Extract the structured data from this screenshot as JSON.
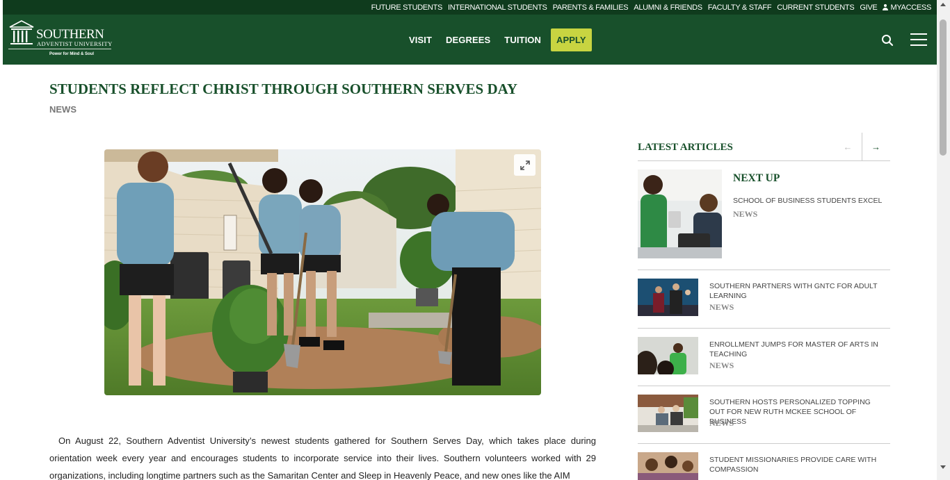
{
  "utility_nav": [
    "FUTURE STUDENTS",
    "INTERNATIONAL STUDENTS",
    "PARENTS & FAMILIES",
    "ALUMNI & FRIENDS",
    "FACULTY & STAFF",
    "CURRENT STUDENTS",
    "GIVE",
    "MYACCESS"
  ],
  "logo": {
    "line1": "SOUTHERN",
    "line2": "ADVENTIST UNIVERSITY",
    "tagline": "Power for Mind & Soul"
  },
  "main_nav": {
    "visit": "VISIT",
    "degrees": "DEGREES",
    "tuition": "TUITION",
    "apply": "APPLY"
  },
  "article": {
    "title": "STUDENTS REFLECT CHRIST THROUGH SOUTHERN SERVES DAY",
    "category": "NEWS",
    "hero_alt": "Students digging and planting shrubs in a yard",
    "body": "On August 22, Southern Adventist University’s newest students gathered for Southern Serves Day, which takes place during orientation week every year and encourages students to incorporate service into their lives. Southern volunteers worked with 29 organizations, including longtime partners such as the Samaritan Center and Sleep in Heavenly Peace, and new ones like the AIM"
  },
  "sidebar": {
    "heading": "LATEST ARTICLES",
    "prev": "←",
    "next": "→",
    "featured": {
      "label": "NEXT UP",
      "title": "SCHOOL OF BUSINESS STUDENTS EXCEL",
      "category": "NEWS"
    },
    "items": [
      {
        "title": "SOUTHERN PARTNERS WITH GNTC FOR ADULT LEARNING",
        "category": "NEWS"
      },
      {
        "title": "ENROLLMENT JUMPS FOR MASTER OF ARTS IN TEACHING",
        "category": "NEWS"
      },
      {
        "title": "SOUTHERN HOSTS PERSONALIZED TOPPING OUT FOR NEW RUTH MCKEE SCHOOL OF BUSINESS",
        "category": "NEWS"
      },
      {
        "title": "STUDENT MISSIONARIES PROVIDE CARE WITH COMPASSION",
        "category": ""
      }
    ]
  },
  "colors": {
    "brand_dark": "#0f3b1d",
    "brand": "#18502b",
    "apply": "#c8d441"
  },
  "icons": [
    "user-icon",
    "search-icon",
    "hamburger-menu-icon",
    "expand-icon",
    "arrow-left-icon",
    "arrow-right-icon"
  ]
}
